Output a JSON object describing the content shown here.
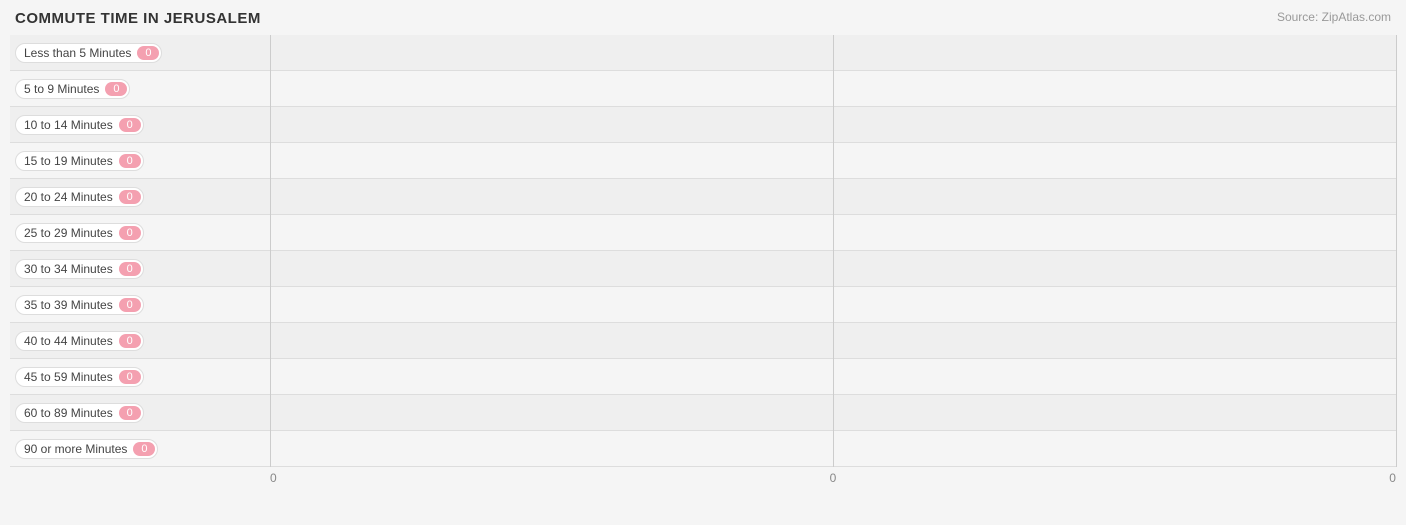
{
  "title": "COMMUTE TIME IN JERUSALEM",
  "source": "Source: ZipAtlas.com",
  "rows": [
    {
      "label": "Less than 5 Minutes",
      "value": 0
    },
    {
      "label": "5 to 9 Minutes",
      "value": 0
    },
    {
      "label": "10 to 14 Minutes",
      "value": 0
    },
    {
      "label": "15 to 19 Minutes",
      "value": 0
    },
    {
      "label": "20 to 24 Minutes",
      "value": 0
    },
    {
      "label": "25 to 29 Minutes",
      "value": 0
    },
    {
      "label": "30 to 34 Minutes",
      "value": 0
    },
    {
      "label": "35 to 39 Minutes",
      "value": 0
    },
    {
      "label": "40 to 44 Minutes",
      "value": 0
    },
    {
      "label": "45 to 59 Minutes",
      "value": 0
    },
    {
      "label": "60 to 89 Minutes",
      "value": 0
    },
    {
      "label": "90 or more Minutes",
      "value": 0
    }
  ],
  "xaxis": {
    "labels": [
      "0",
      "0",
      "0"
    ]
  },
  "colors": {
    "bar": "#f4a0b0",
    "badge": "#f4a0b0"
  }
}
